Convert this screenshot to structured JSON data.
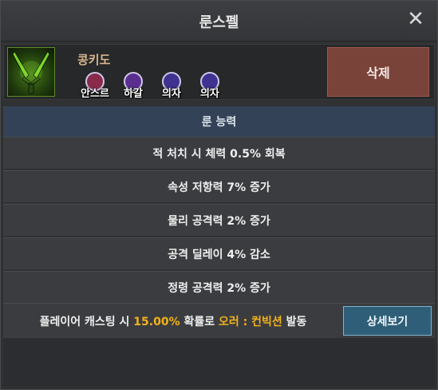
{
  "window": {
    "title": "룬스펠"
  },
  "rune": {
    "name": "콩키도",
    "icon": "twin-green-daggers-icon",
    "tags": [
      {
        "label": "안스르",
        "color": "#8a2a4a"
      },
      {
        "label": "하갈",
        "color": "#5a2f8f"
      },
      {
        "label": "의자",
        "color": "#3f3290"
      },
      {
        "label": "의자",
        "color": "#3f3290"
      }
    ],
    "delete_label": "삭제"
  },
  "abilities": {
    "header": "룬 능력",
    "items": [
      "적 처치 시 체력 0.5% 회복",
      "속성 저항력 7% 증가",
      "물리 공격력 2% 증가",
      "공격 딜레이 4% 감소",
      "정령 공격력 2% 증가"
    ]
  },
  "effect": {
    "prefix": "플레이어 캐스팅 시 ",
    "chance": "15.00%",
    "mid": " 확률로 ",
    "skill": "오러 : 컨빅션",
    "suffix": " 발동",
    "detail_label": "상세보기"
  },
  "colors": {
    "highlight": "#f2b21c",
    "delete_button": "#7a4339",
    "detail_button": "#2f5f78",
    "section_header": "#334256"
  }
}
